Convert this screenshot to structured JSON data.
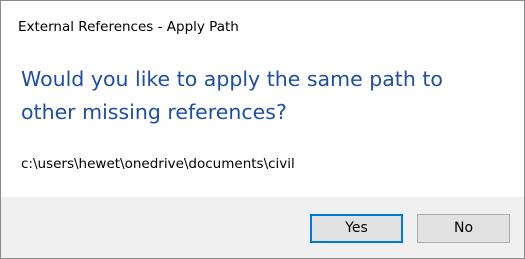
{
  "dialog": {
    "title": "External References - Apply Path",
    "instruction": "Would you like to apply the same path to other missing references?",
    "path": "c:\\users\\hewet\\onedrive\\documents\\civil",
    "buttons": {
      "yes_label": "Yes",
      "no_label": "No"
    }
  },
  "colors": {
    "instruction_text": "#1e4fa3",
    "footer_background": "#f0f0f0",
    "default_button_border": "#0078d7"
  }
}
